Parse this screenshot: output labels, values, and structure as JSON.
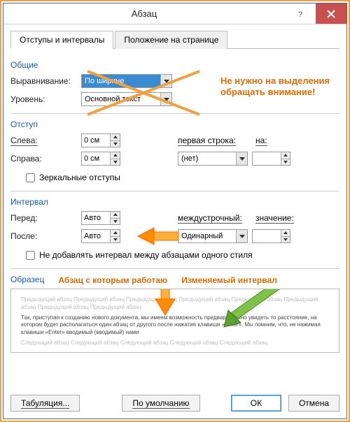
{
  "window": {
    "title": "Абзац"
  },
  "tabs": {
    "indent": "Отступы и интервалы",
    "position": "Положение на странице"
  },
  "general": {
    "header": "Общие",
    "alignment_label": "Выравнивание:",
    "alignment_value": "По ширине",
    "outline_label": "Уровень:",
    "outline_value": "Основной текст",
    "note": "Не нужно на выделения обращать внимание!"
  },
  "indent": {
    "header": "Отступ",
    "left_label": "Слева:",
    "left_value": "0 см",
    "right_label": "Справа:",
    "right_value": "0 см",
    "first_line_label": "первая строка:",
    "first_line_value": "(нет)",
    "by_label": "на:",
    "by_value": "",
    "mirror_label": "Зеркальные отступы"
  },
  "spacing": {
    "header": "Интервал",
    "before_label": "Перед:",
    "before_value": "Авто",
    "after_label": "После:",
    "after_value": "Авто",
    "line_label": "междустрочный:",
    "line_value": "Одинарный",
    "at_label": "значение:",
    "at_value": "",
    "nospace_label": "Не добавлять интервал между абзацами одного стиля"
  },
  "preview": {
    "header": "Образец",
    "note1": "Абзац с которым работаю",
    "note2": "Изменяемый интервал",
    "prev_line": "Предыдущий абзац Предыдущий абзац Предыдущий абзац Предыдущий абзац Предыдущий абзац Предыдущий абзац Предыдущий абзац Предыдущий абзац",
    "main_text": "Так, приступая к созданию нового документа, мы имеем возможность предварительно увидеть то расстояние, на котором будет располагаться один абзац от другого после нажатия клавиши «Enter». Мы помним, что, не нажимая клавиши «Enter» вводимый (вводимый) нами",
    "next_line": "Следующий абзац Следующий абзац Следующий абзац Следующий абзац Следующий абзац"
  },
  "buttons": {
    "tabs": "Табуляция...",
    "defaults": "По умолчанию",
    "ok": "ОК",
    "cancel": "Отмена"
  }
}
